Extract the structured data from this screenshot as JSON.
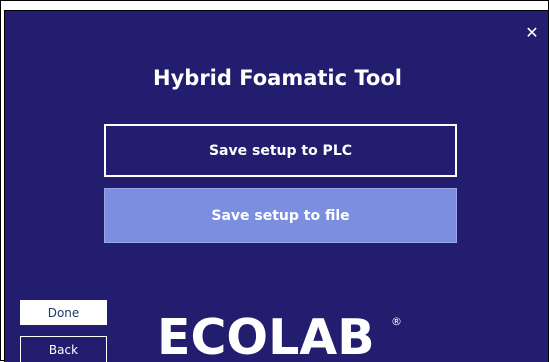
{
  "dialog": {
    "close_label": "✕",
    "title": "Hybrid Foamatic Tool",
    "buttons": {
      "save_plc": "Save setup to PLC",
      "save_file": "Save setup to file",
      "done": "Done",
      "back": "Back"
    },
    "logo": {
      "text": "ECOLAB",
      "registered": "®"
    }
  },
  "colors": {
    "background": "#221d6e",
    "secondary_button": "#7b8ee0",
    "text": "#ffffff"
  }
}
